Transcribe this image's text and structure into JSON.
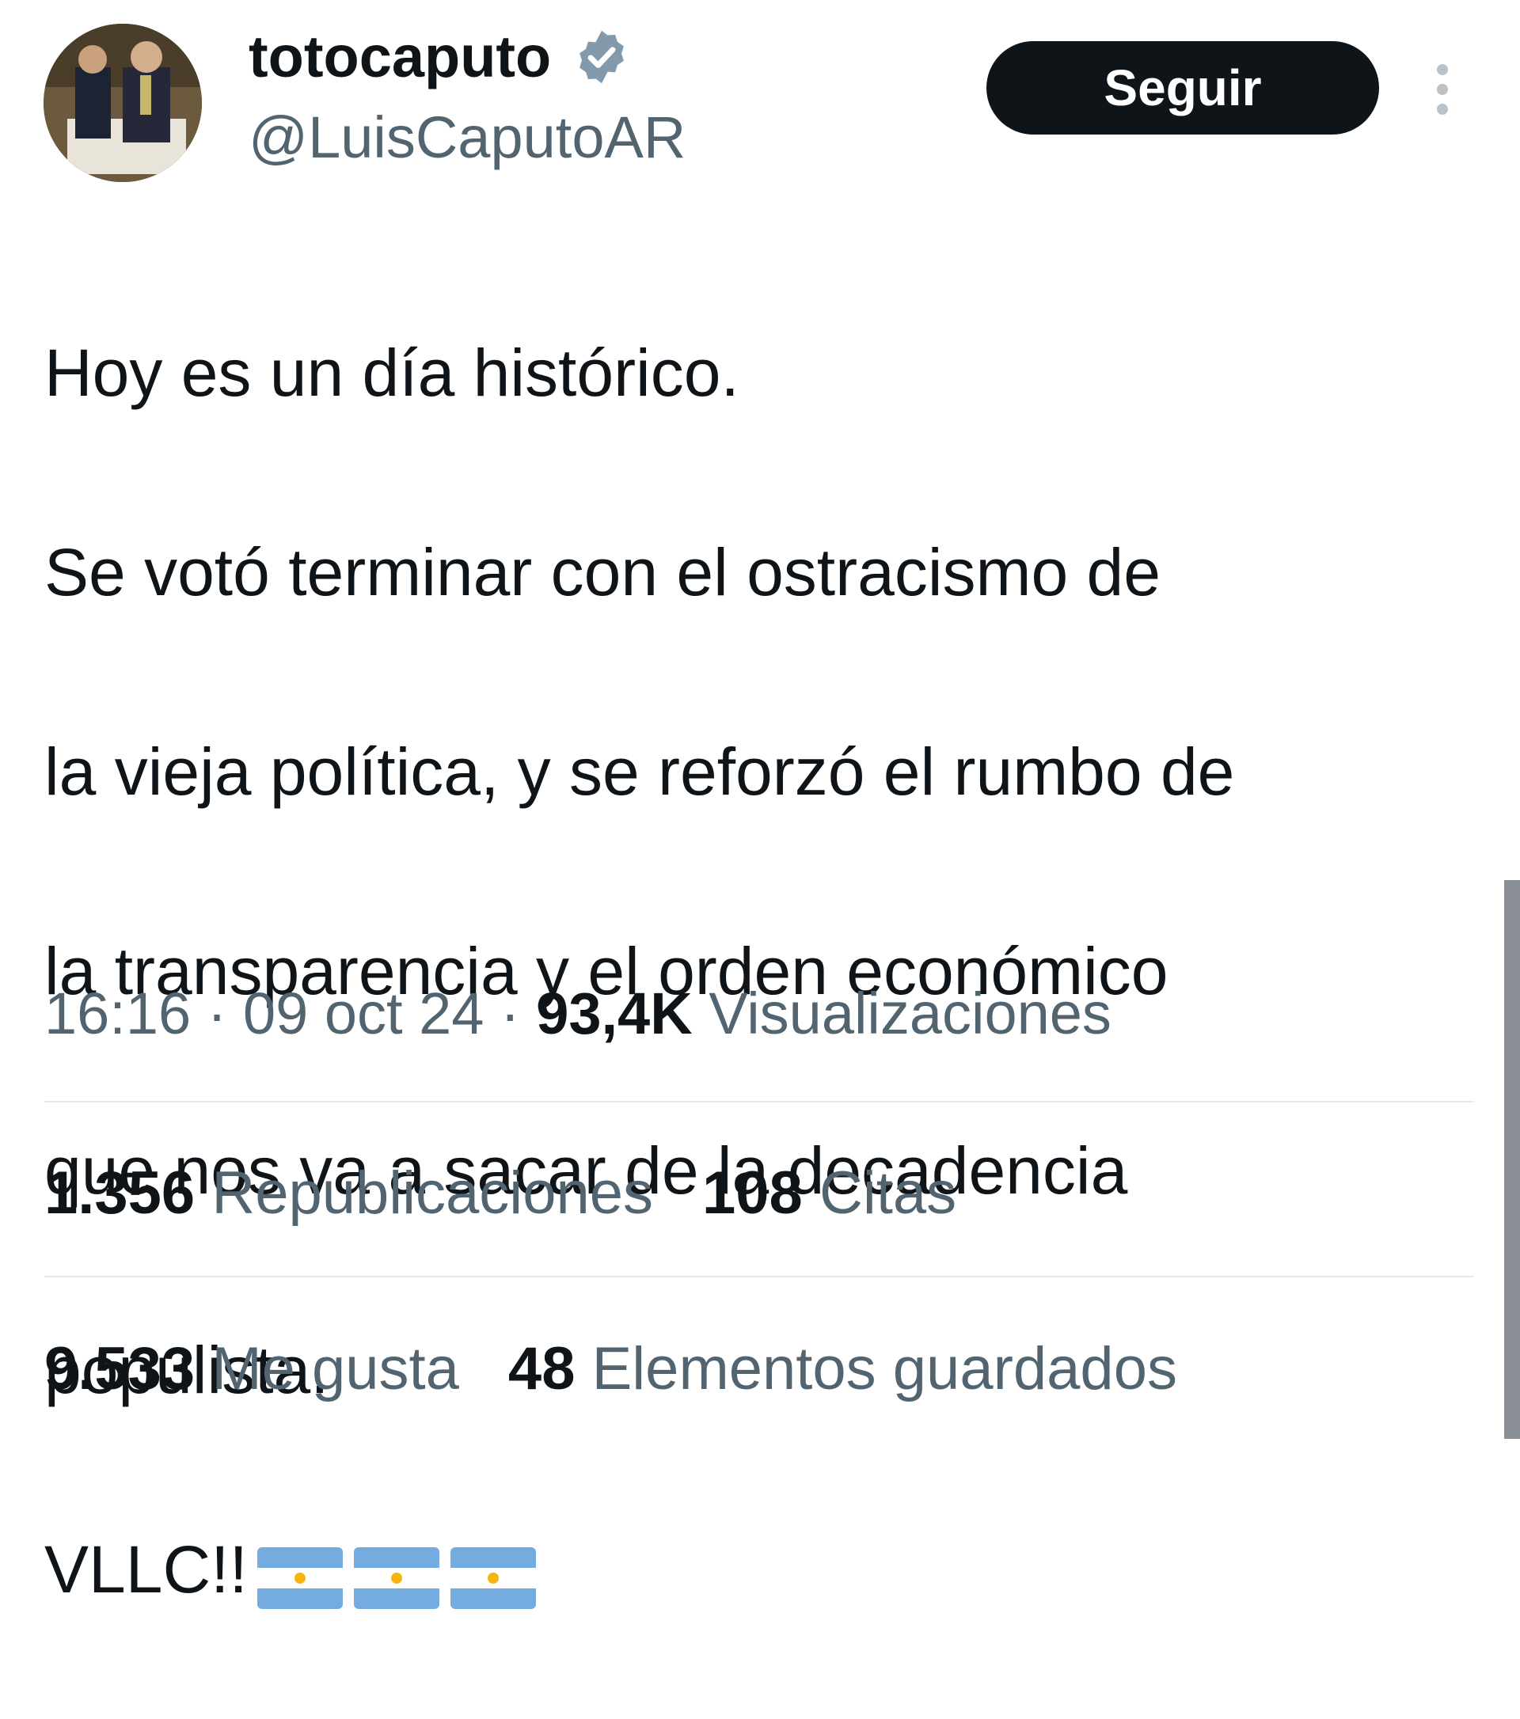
{
  "author": {
    "display_name": "totocaputo",
    "handle": "@LuisCaputoAR",
    "verified_icon": "verified-badge-icon"
  },
  "follow_button": {
    "label": "Seguir"
  },
  "tweet": {
    "lines": [
      "Hoy es un día histórico.",
      "Se votó terminar con el ostracismo de",
      "la vieja política, y se reforzó el rumbo de",
      "la transparencia y el orden económico",
      "que nos va a sacar de la decadencia",
      "populista."
    ],
    "closing": "VLLC!!",
    "emoji": [
      "argentina-flag-icon",
      "argentina-flag-icon",
      "argentina-flag-icon"
    ]
  },
  "meta": {
    "time": "16:16",
    "separator": " · ",
    "date": "09 oct 24",
    "views_count": "93,4K",
    "views_label": "Visualizaciones"
  },
  "stats": {
    "reposts_count": "1.356",
    "reposts_label": "Republicaciones",
    "quotes_count": "108",
    "quotes_label": "Citas",
    "likes_count": "9.533",
    "likes_label": "Me gusta",
    "bookmarks_count": "48",
    "bookmarks_label": "Elementos guardados"
  },
  "colors": {
    "text_primary": "#0f1419",
    "text_secondary": "#536471",
    "button_bg": "#0f1419",
    "verified_badge": "#829aab",
    "flag_blue": "#74acdf",
    "flag_sun": "#f6b40e"
  }
}
